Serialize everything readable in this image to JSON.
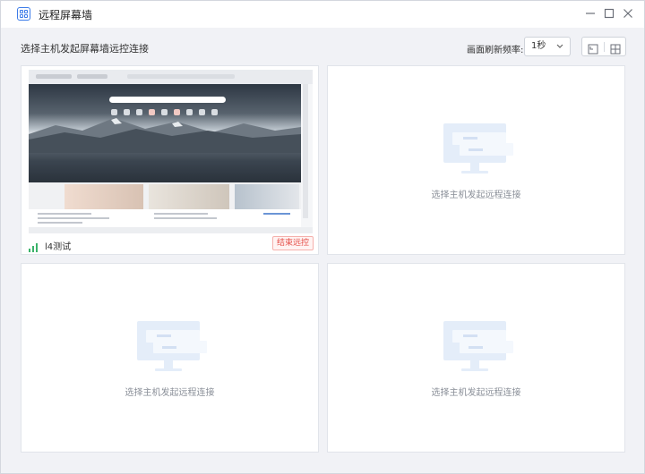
{
  "window": {
    "title": "远程屏幕墙",
    "icon": "screen-wall-icon",
    "controls": [
      "minimize-icon",
      "maximize-icon",
      "close-icon"
    ]
  },
  "toolbar": {
    "instruction": "选择主机发起屏幕墙远控连接",
    "refresh_rate_label": "画面刷新频率:",
    "refresh_rate_value": "1秒",
    "view_buttons": [
      "single-view-icon",
      "grid-view-icon"
    ]
  },
  "panels": [
    {
      "host_name": "l4测试",
      "status_icon": "signal-icon",
      "status_color": "#3bb36a",
      "action_label": "结束远控"
    },
    {
      "empty_text": "选择主机发起远程连接",
      "icon": "monitor-placeholder-icon"
    },
    {
      "empty_text": "选择主机发起远程连接",
      "icon": "monitor-placeholder-icon"
    },
    {
      "empty_text": "选择主机发起远程连接",
      "icon": "monitor-placeholder-icon"
    }
  ],
  "colors": {
    "accent": "#3b7be8",
    "danger": "#e5504a",
    "placeholder": "#dbe7f7"
  }
}
